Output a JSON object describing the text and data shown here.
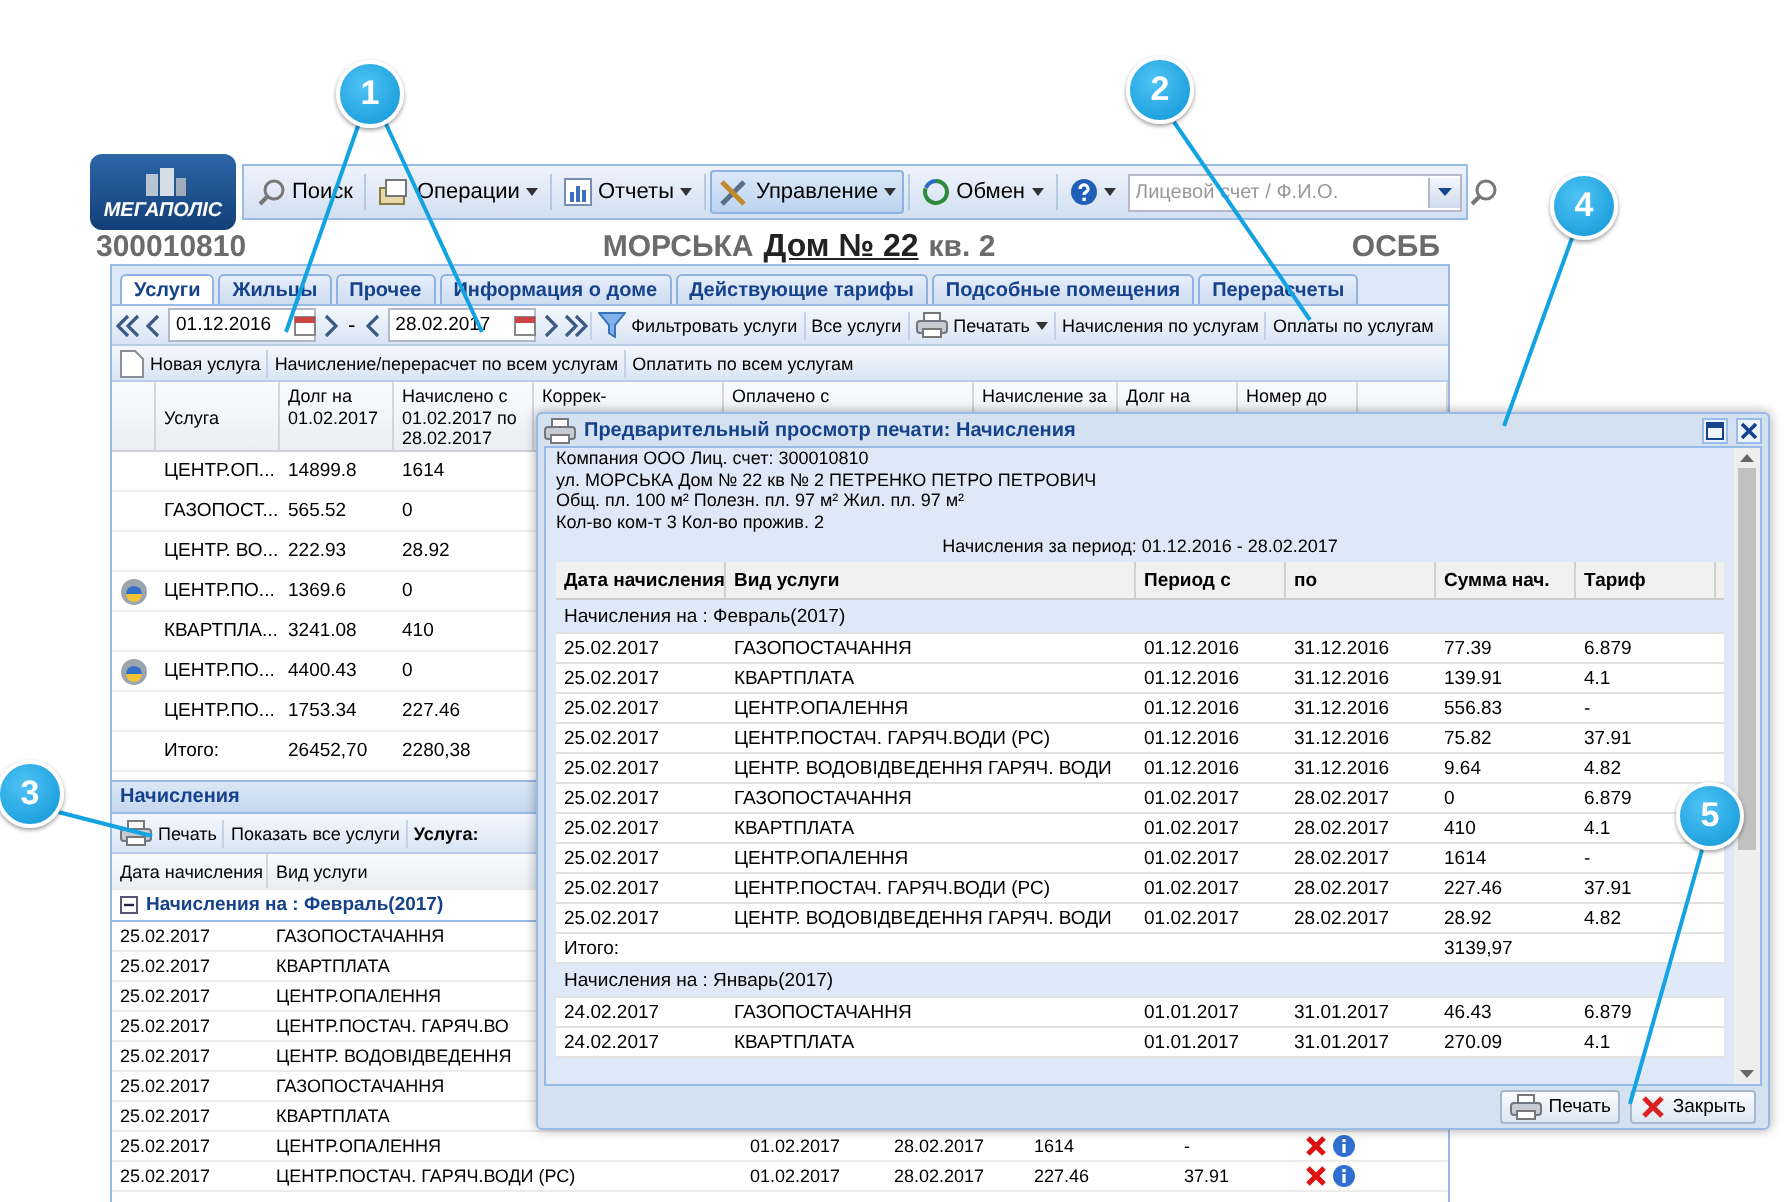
{
  "logo": {
    "text": "МЕГАПОЛІС"
  },
  "toolbar": {
    "items": [
      {
        "kind": "search",
        "label": "Поиск",
        "menu": false,
        "pressed": false
      },
      {
        "kind": "operations",
        "label": "Операции",
        "menu": true,
        "pressed": false
      },
      {
        "kind": "reports",
        "label": "Отчеты",
        "menu": true,
        "pressed": false
      },
      {
        "kind": "manage",
        "label": "Управление",
        "menu": true,
        "pressed": true
      },
      {
        "kind": "exchange",
        "label": "Обмен",
        "menu": true,
        "pressed": false
      },
      {
        "kind": "help",
        "menu": true,
        "pressed": false
      }
    ],
    "search": {
      "placeholder": "Лицевой счет / Ф.И.О."
    }
  },
  "account": {
    "number": "300010810",
    "street": "МОРСЬКА",
    "house": "Дом № 22",
    "apartment": "кв. 2",
    "type": "ОСББ"
  },
  "tabs": [
    {
      "label": "Услуги",
      "selected": true
    },
    {
      "label": "Жильцы",
      "selected": false
    },
    {
      "label": "Прочее",
      "selected": false
    },
    {
      "label": "Информация о доме",
      "selected": false
    },
    {
      "label": "Действующие тарифы",
      "selected": false
    },
    {
      "label": "Подсобные помещения",
      "selected": false
    },
    {
      "label": "Перерасчеты",
      "selected": false
    }
  ],
  "period_bar": {
    "date_from": "01.12.2016",
    "separator": "-",
    "date_to": "28.02.2017",
    "actions": [
      {
        "kind": "filter",
        "label": "Фильтровать услуги",
        "menu": false
      },
      {
        "kind": "plain",
        "label": "Все услуги",
        "menu": false
      },
      {
        "kind": "print",
        "label": "Печатать",
        "menu": true
      },
      {
        "kind": "plain",
        "label": "Начисления по услугам",
        "menu": false
      },
      {
        "kind": "plain",
        "label": "Оплаты по услугам",
        "menu": false
      }
    ]
  },
  "actions_bar": [
    {
      "kind": "new",
      "label": "Новая услуга"
    },
    {
      "kind": "plain",
      "label": "Начисление/перерасчет по всем услугам"
    },
    {
      "kind": "plain",
      "label": "Оплатить по всем услугам"
    }
  ],
  "services_table": {
    "columns": [
      "Услуга",
      "Долг на 01.02.2017",
      "Начислено с 01.02.2017 по 28.02.2017",
      "Коррек-",
      "Оплачено с",
      "Начисление за",
      "Долг на",
      "Номер до"
    ],
    "rows": [
      {
        "flagged": false,
        "cells": [
          "ЦЕНТР.ОП...",
          "14899.8",
          "1614"
        ]
      },
      {
        "flagged": false,
        "cells": [
          "ГАЗОПОСТ...",
          "565.52",
          "0"
        ]
      },
      {
        "flagged": false,
        "cells": [
          "ЦЕНТР. ВО...",
          "222.93",
          "28.92"
        ]
      },
      {
        "flagged": true,
        "cells": [
          "ЦЕНТР.ПО...",
          "1369.6",
          "0"
        ]
      },
      {
        "flagged": false,
        "cells": [
          "КВАРТПЛА...",
          "3241.08",
          "410"
        ]
      },
      {
        "flagged": true,
        "cells": [
          "ЦЕНТР.ПО...",
          "4400.43",
          "0"
        ]
      },
      {
        "flagged": false,
        "cells": [
          "ЦЕНТР.ПО...",
          "1753.34",
          "227.46"
        ]
      }
    ],
    "total": [
      "Итого:",
      "26452,70",
      "2280,38"
    ]
  },
  "accruals_panel": {
    "title": "Начисления",
    "toolbar": [
      {
        "kind": "print",
        "label": "Печать"
      },
      {
        "kind": "plain",
        "label": "Показать все услуги"
      }
    ],
    "filter_label": "Услуга:",
    "columns": [
      "Дата начисления",
      "Вид услуги"
    ],
    "group": {
      "label": "Начисления на : Февраль(2017)",
      "expanded": true
    },
    "rows": [
      {
        "actions": false,
        "cells": [
          "25.02.2017",
          "ГАЗОПОСТАЧАННЯ"
        ]
      },
      {
        "actions": false,
        "cells": [
          "25.02.2017",
          "КВАРТПЛАТА"
        ]
      },
      {
        "actions": false,
        "cells": [
          "25.02.2017",
          "ЦЕНТР.ОПАЛЕННЯ"
        ]
      },
      {
        "actions": false,
        "cells": [
          "25.02.2017",
          "ЦЕНТР.ПОСТАЧ. ГАРЯЧ.ВО"
        ]
      },
      {
        "actions": false,
        "cells": [
          "25.02.2017",
          "ЦЕНТР. ВОДОВІДВЕДЕННЯ"
        ]
      },
      {
        "actions": false,
        "cells": [
          "25.02.2017",
          "ГАЗОПОСТАЧАННЯ"
        ]
      },
      {
        "actions": false,
        "cells": [
          "25.02.2017",
          "КВАРТПЛАТА"
        ]
      },
      {
        "actions": true,
        "cells": [
          "25.02.2017",
          "ЦЕНТР.ОПАЛЕННЯ",
          "01.02.2017",
          "28.02.2017",
          "1614",
          "-"
        ]
      },
      {
        "actions": true,
        "cells": [
          "25.02.2017",
          "ЦЕНТР.ПОСТАЧ. ГАРЯЧ.ВОДИ (РС)",
          "01.02.2017",
          "28.02.2017",
          "227.46",
          "37.91"
        ]
      }
    ]
  },
  "print_preview": {
    "title": "Предварительный просмотр печати: Начисления",
    "info_lines": [
      "Компания ООО  Лиц. счет: 300010810",
      "ул. МОРСЬКА Дом № 22 кв № 2  ПЕТРЕНКО ПЕТРО ПЕТРОВИЧ",
      "Общ. пл. 100 м²  Полезн. пл. 97 м²  Жил. пл. 97 м²",
      "Кол-во ком-т 3  Кол-во прожив. 2"
    ],
    "period": "Начисления за период: 01.12.2016 - 28.02.2017",
    "columns": [
      "Дата начисления",
      "Вид услуги",
      "Период с",
      "по",
      "Сумма нач.",
      "Тариф"
    ],
    "rows": [
      {
        "kind": "group",
        "label": "Начисления на : Февраль(2017)"
      },
      {
        "kind": "data",
        "cells": [
          "25.02.2017",
          "ГАЗОПОСТАЧАННЯ",
          "01.12.2016",
          "31.12.2016",
          "77.39",
          "6.879"
        ]
      },
      {
        "kind": "data",
        "cells": [
          "25.02.2017",
          "КВАРТПЛАТА",
          "01.12.2016",
          "31.12.2016",
          "139.91",
          "4.1"
        ]
      },
      {
        "kind": "data",
        "cells": [
          "25.02.2017",
          "ЦЕНТР.ОПАЛЕННЯ",
          "01.12.2016",
          "31.12.2016",
          "556.83",
          "-"
        ]
      },
      {
        "kind": "data",
        "cells": [
          "25.02.2017",
          "ЦЕНТР.ПОСТАЧ. ГАРЯЧ.ВОДИ (РС)",
          "01.12.2016",
          "31.12.2016",
          "75.82",
          "37.91"
        ]
      },
      {
        "kind": "data",
        "cells": [
          "25.02.2017",
          "ЦЕНТР. ВОДОВІДВЕДЕННЯ ГАРЯЧ. ВОДИ",
          "01.12.2016",
          "31.12.2016",
          "9.64",
          "4.82"
        ]
      },
      {
        "kind": "data",
        "cells": [
          "25.02.2017",
          "ГАЗОПОСТАЧАННЯ",
          "01.02.2017",
          "28.02.2017",
          "0",
          "6.879"
        ]
      },
      {
        "kind": "data",
        "cells": [
          "25.02.2017",
          "КВАРТПЛАТА",
          "01.02.2017",
          "28.02.2017",
          "410",
          "4.1"
        ]
      },
      {
        "kind": "data",
        "cells": [
          "25.02.2017",
          "ЦЕНТР.ОПАЛЕННЯ",
          "01.02.2017",
          "28.02.2017",
          "1614",
          "-"
        ]
      },
      {
        "kind": "data",
        "cells": [
          "25.02.2017",
          "ЦЕНТР.ПОСТАЧ. ГАРЯЧ.ВОДИ (РС)",
          "01.02.2017",
          "28.02.2017",
          "227.46",
          "37.91"
        ]
      },
      {
        "kind": "data",
        "cells": [
          "25.02.2017",
          "ЦЕНТР. ВОДОВІДВЕДЕННЯ ГАРЯЧ. ВОДИ",
          "01.02.2017",
          "28.02.2017",
          "28.92",
          "4.82"
        ]
      },
      {
        "kind": "total",
        "label": "Итого:",
        "sum": "3139,97"
      },
      {
        "kind": "group",
        "label": "Начисления на : Январь(2017)"
      },
      {
        "kind": "data",
        "cells": [
          "24.02.2017",
          "ГАЗОПОСТАЧАННЯ",
          "01.01.2017",
          "31.01.2017",
          "46.43",
          "6.879"
        ]
      },
      {
        "kind": "data",
        "cells": [
          "24.02.2017",
          "КВАРТПЛАТА",
          "01.01.2017",
          "31.01.2017",
          "270.09",
          "4.1"
        ]
      }
    ],
    "buttons": [
      {
        "kind": "print",
        "label": "Печать"
      },
      {
        "kind": "close",
        "label": "Закрыть"
      }
    ]
  },
  "callouts": [
    {
      "number": "1"
    },
    {
      "number": "2"
    },
    {
      "number": "3"
    },
    {
      "number": "4"
    },
    {
      "number": "5"
    }
  ]
}
